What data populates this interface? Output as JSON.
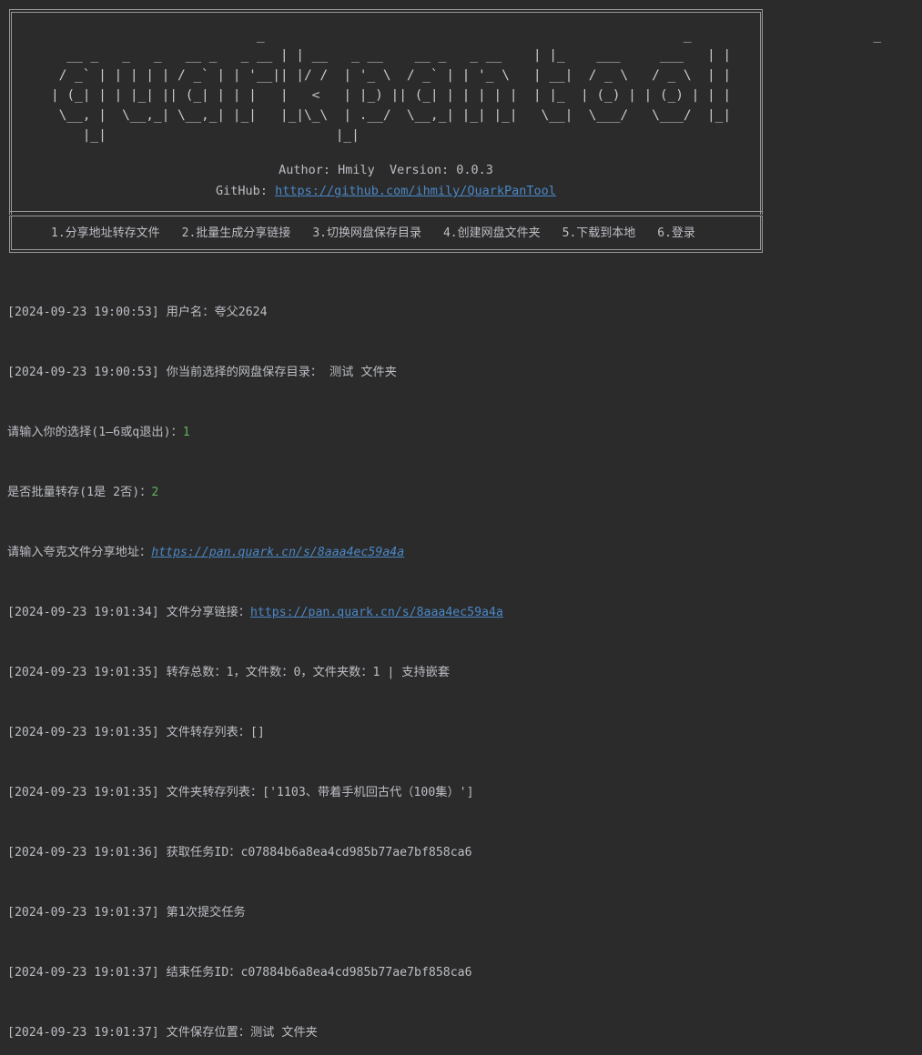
{
  "banner": {
    "ascii_art": "                          _                                                     _                       _   \n  __ _   _   _   __ _   _ __ | | __   _ __    __ _   _ __    | |_    ___     ___   | |  \n / _` | | | | | / _` | | '__|| |/ /  | '_ \\  / _` | | '_ \\   | __|  / _ \\   / _ \\  | |  \n| (_| | | |_| || (_| | | |   |   <   | |_) || (_| | | | | |  | |_  | (_) | | (_) | | |  \n \\__, |  \\__,_| \\__,_| |_|   |_|\\_\\  | .__/  \\__,_| |_| |_|   \\__|  \\___/   \\___/  |_|  \n    |_|                             |_|                                                ",
    "author_line": "Author: Hmily  Version: 0.0.3",
    "github_label": "GitHub: ",
    "github_url": "https://github.com/ihmily/QuarkPanTool"
  },
  "menu": {
    "items": [
      "1.分享地址转存文件",
      "2.批量生成分享链接",
      "3.切换网盘保存目录",
      "4.创建网盘文件夹",
      "5.下载到本地",
      "6.登录"
    ]
  },
  "log": {
    "line1": "[2024-09-23 19:00:53] 用户名：夸父2624",
    "line2": "[2024-09-23 19:00:53] 你当前选择的网盘保存目录： 测试 文件夹",
    "line3_prompt": "请输入你的选择(1—6或q退出)：",
    "line3_value": "1",
    "line4_prompt": "是否批量转存(1是 2否)：",
    "line4_value": "2",
    "line5_prompt": "请输入夸克文件分享地址：",
    "line5_url": "https://pan.quark.cn/s/8aaa4ec59a4a",
    "line6_prefix": "[2024-09-23 19:01:34] 文件分享链接：",
    "line6_url": "https://pan.quark.cn/s/8aaa4ec59a4a",
    "line7": "[2024-09-23 19:01:35] 转存总数：1，文件数：0，文件夹数：1 | 支持嵌套",
    "line8": "[2024-09-23 19:01:35] 文件转存列表：[]",
    "line9": "[2024-09-23 19:01:35] 文件夹转存列表：['1103、带着手机回古代（100集）']",
    "line10": "[2024-09-23 19:01:36] 获取任务ID：c07884b6a8ea4cd985b77ae7bf858ca6",
    "line11": "[2024-09-23 19:01:37] 第1次提交任务",
    "line12": "[2024-09-23 19:01:37] 结束任务ID：c07884b6a8ea4cd985b77ae7bf858ca6",
    "line13": "[2024-09-23 19:01:37] 文件保存位置：测试 文件夹"
  },
  "colors": {
    "background": "#2b2b2b",
    "text": "#bcbec4",
    "link": "#4a88c7",
    "input_value": "#5fb35f",
    "frame": "#9a9a9a"
  }
}
